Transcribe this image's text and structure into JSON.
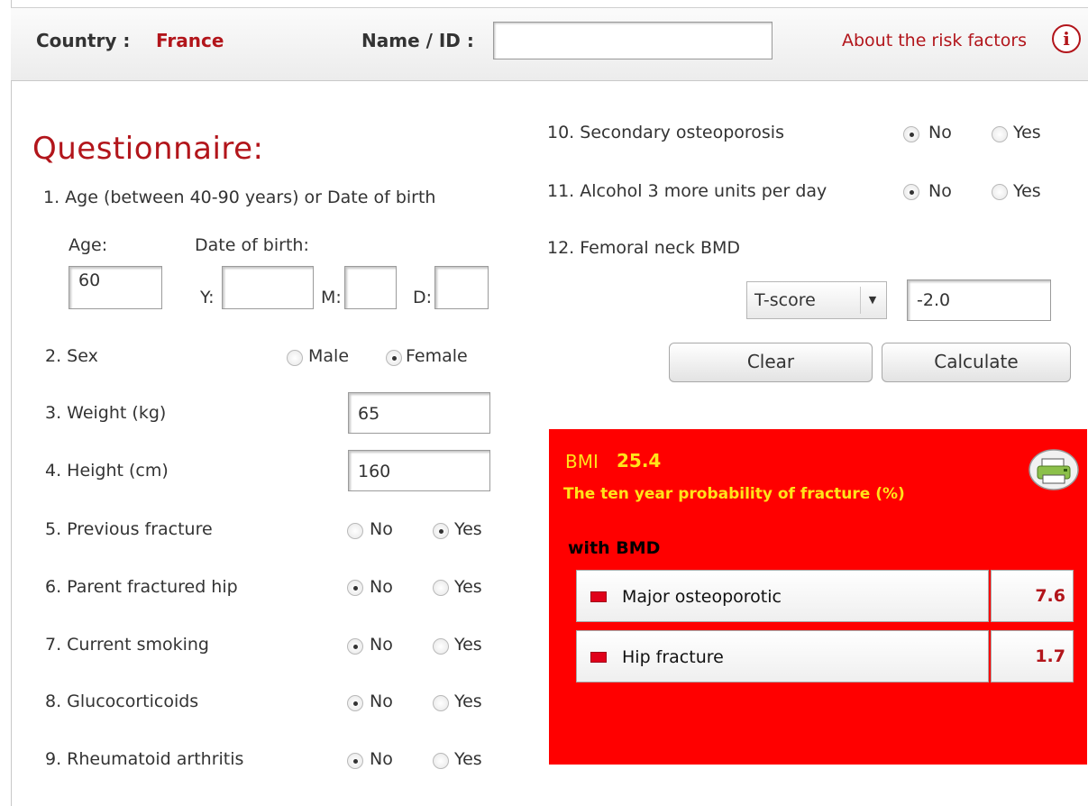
{
  "header": {
    "country_label": "Country :",
    "country_value": "France",
    "name_label": "Name / ID :",
    "name_value": "",
    "about_link": "About the risk factors",
    "info_icon_glyph": "i"
  },
  "questionnaire": {
    "title": "Questionnaire:",
    "q1": {
      "label": "1. Age (between 40-90 years) or Date of birth",
      "age_label": "Age:",
      "dob_label": "Date of birth:",
      "age_value": "60",
      "y_label": "Y:",
      "m_label": "M:",
      "d_label": "D:",
      "y_value": "",
      "m_value": "",
      "d_value": ""
    },
    "q2": {
      "label": "2. Sex",
      "opt1": "Male",
      "opt2": "Female",
      "selected": "Female"
    },
    "q3": {
      "label": "3. Weight (kg)",
      "value": "65"
    },
    "q4": {
      "label": "4. Height (cm)",
      "value": "160"
    },
    "q5": {
      "label": "5. Previous fracture",
      "opt1": "No",
      "opt2": "Yes",
      "selected": "Yes"
    },
    "q6": {
      "label": "6. Parent fractured hip",
      "opt1": "No",
      "opt2": "Yes",
      "selected": "No"
    },
    "q7": {
      "label": "7. Current smoking",
      "opt1": "No",
      "opt2": "Yes",
      "selected": "No"
    },
    "q8": {
      "label": "8. Glucocorticoids",
      "opt1": "No",
      "opt2": "Yes",
      "selected": "No"
    },
    "q9": {
      "label": "9. Rheumatoid arthritis",
      "opt1": "No",
      "opt2": "Yes",
      "selected": "No"
    },
    "q10": {
      "label": "10. Secondary osteoporosis",
      "opt1": "No",
      "opt2": "Yes",
      "selected": "No"
    },
    "q11": {
      "label": "11. Alcohol 3 more units per day",
      "opt1": "No",
      "opt2": "Yes",
      "selected": "No"
    },
    "q12": {
      "label": "12. Femoral neck BMD",
      "select_value": "T-score",
      "value": "-2.0"
    }
  },
  "buttons": {
    "clear": "Clear",
    "calculate": "Calculate"
  },
  "result": {
    "bmi_label": "BMI",
    "bmi_value": "25.4",
    "prob_title": "The ten year probability of fracture (%)",
    "with_bmd": "with BMD",
    "rows": [
      {
        "label": "Major osteoporotic",
        "value": "7.6"
      },
      {
        "label": "Hip fracture",
        "value": "1.7"
      }
    ],
    "printer_icon": "printer-icon"
  },
  "colors": {
    "brand_red": "#b2151b",
    "result_bg": "#ff0000",
    "highlight_yellow": "#ffe31a"
  }
}
